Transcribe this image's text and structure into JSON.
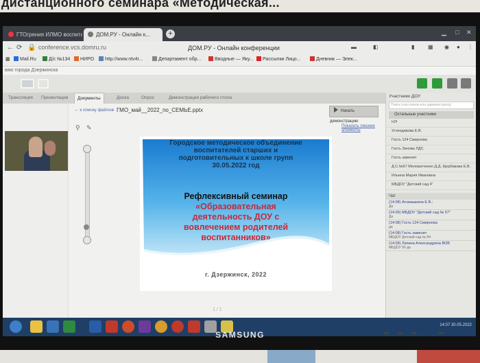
{
  "photo_caption": "дистанционного семинара «Методическая...",
  "browser": {
    "tabs": [
      "ГТОгрения ИЛМО воспитат...",
      "ДОМ.РУ - Онлайн к..."
    ],
    "new_tab": "+",
    "window_title": "ДОМ.РУ - Онлайн конференции",
    "url": "conference.vcs.domru.ru",
    "bookmarks": [
      "Mail.Ru",
      "Д/с №134",
      "НИРО",
      "http://www.ntv4r...",
      "Департамент обр...",
      "Вводные — Яку...",
      "Рассылки Лицо...",
      "Дневник — Элек..."
    ],
    "page_header": "вяю города Дзержинска"
  },
  "conference": {
    "sections": [
      "Трансляция",
      "Презентации",
      "Документы",
      "Доска",
      "Опрос",
      "Демонстрация рабочего стола"
    ],
    "active_section": "Документы",
    "back_link": "к списку файлов",
    "file_name": "ГМО_май__2022_по_СЕМЬЕ.pptx",
    "present_button": "Начать демонстрацию",
    "show_all_link": "Показать лишние элементы",
    "slide": {
      "heading_lines": [
        "Городское методическое объединение",
        "воспитателей старших и",
        "подготовительных к школе групп",
        "30.05.2022 год"
      ],
      "seminar": "Рефлексивный семинар",
      "topic_lines": [
        "«Образовательная",
        "деятельность ДОУ с",
        "вовлечением родителей",
        "воспитанников»"
      ],
      "city": "г. Дзержинск, 2022"
    },
    "pager": "1 / 1",
    "participants_title": "Участники ДОУ",
    "participants_search": "Поиск участников или администратор",
    "participants_section": "Остальные участники",
    "participants": [
      "НЭ",
      "Устиндикова Е.В.",
      "Гость 124 Смирнова",
      "Гость Зинова ЛДС",
      "Гость заменит",
      "Д.С.№67 Меловатченко Д.Д. Щербакова Е.В.",
      "Ильина Мария Ивановна",
      "МБДОУ \"Детский сад 4\""
    ],
    "chat_title": "Чат",
    "chat_messages": [
      {
        "user": "(14:08) Атомашкина Е.В.:",
        "text": "Да"
      },
      {
        "user": "(14:09) МБДОУ \"Детский сад № 57\"",
        "text": "Да"
      },
      {
        "user": "(14:08) Гость 124 Смирнова",
        "text": "да"
      },
      {
        "user": "(14:08) Гость заменит",
        "text": "МБДОУ Детский сад № 84"
      },
      {
        "user": "(14:09) Лапина Александрина ВОВ",
        "text": "МБДОУ 90 да"
      }
    ]
  },
  "taskbar": {
    "clock": "14:07\n30.05.2022"
  },
  "monitor_brand": "SAMSUNG"
}
